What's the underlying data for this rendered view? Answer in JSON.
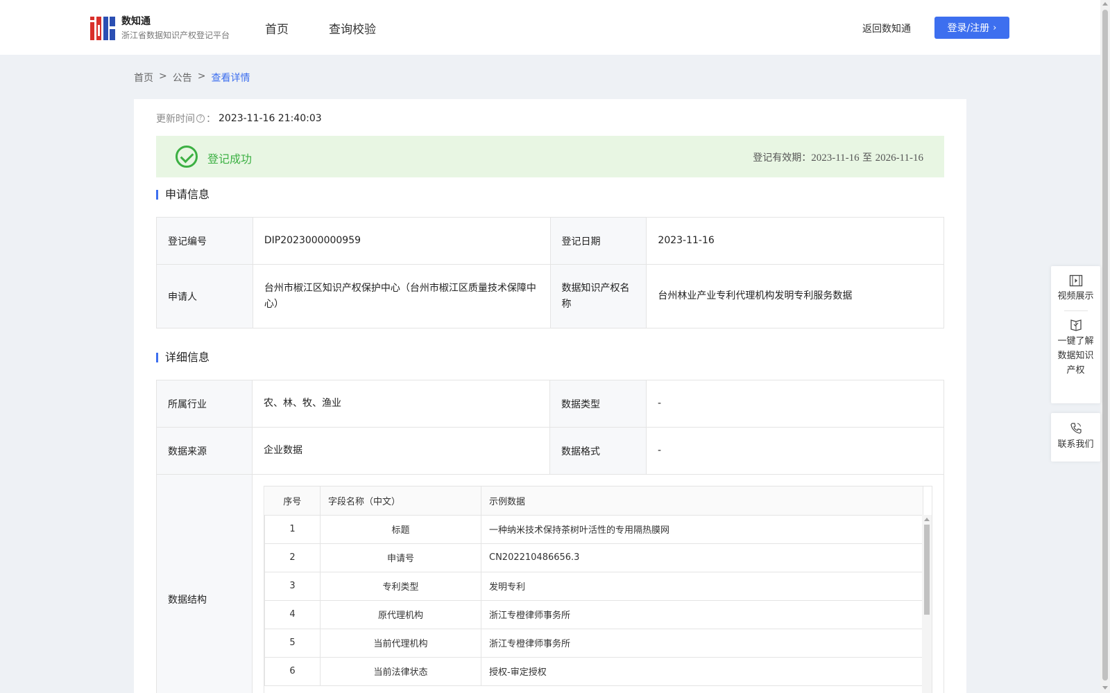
{
  "header": {
    "brand_name": "数知通",
    "brand_sub": "浙江省数据知识产权登记平台",
    "nav": [
      "首页",
      "查询校验"
    ],
    "back_link": "返回数知通",
    "login_button": "登录/注册"
  },
  "breadcrumb": [
    "首页",
    "公告",
    "查看详情"
  ],
  "update": {
    "label": "更新时间",
    "colon": "：",
    "value": "2023-11-16 21:40:03"
  },
  "status": {
    "text": "登记成功",
    "validity_label": "登记有效期：",
    "validity_start": "2023-11-16",
    "validity_sep": " 至 ",
    "validity_end": "2026-11-16"
  },
  "application": {
    "title": "申请信息",
    "reg_no_label": "登记编号",
    "reg_no": "DIP2023000000959",
    "reg_date_label": "登记日期",
    "reg_date": "2023-11-16",
    "applicant_label": "申请人",
    "applicant": "台州市椒江区知识产权保护中心（台州市椒江区质量技术保障中心）",
    "ip_name_label": "数据知识产权名称",
    "ip_name": "台州林业产业专利代理机构发明专利服务数据"
  },
  "detail": {
    "title": "详细信息",
    "industry_label": "所属行业",
    "industry": "农、林、牧、渔业",
    "data_type_label": "数据类型",
    "data_type": "-",
    "source_label": "数据来源",
    "source": "企业数据",
    "format_label": "数据格式",
    "format": "-",
    "structure_label": "数据结构",
    "structure_headers": [
      "序号",
      "字段名称（中文）",
      "示例数据"
    ],
    "structure_rows": [
      [
        "1",
        "标题",
        "一种纳米技术保持茶树叶活性的专用隔热膜网"
      ],
      [
        "2",
        "申请号",
        "CN202210486656.3"
      ],
      [
        "3",
        "专利类型",
        "发明专利"
      ],
      [
        "4",
        "原代理机构",
        "浙江专橙律师事务所"
      ],
      [
        "5",
        "当前代理机构",
        "浙江专橙律师事务所"
      ],
      [
        "6",
        "当前法律状态",
        "授权-审定授权"
      ]
    ]
  },
  "side": {
    "video": "视频展示",
    "learn": "一键了解数据知识产权",
    "contact": "联系我们"
  }
}
